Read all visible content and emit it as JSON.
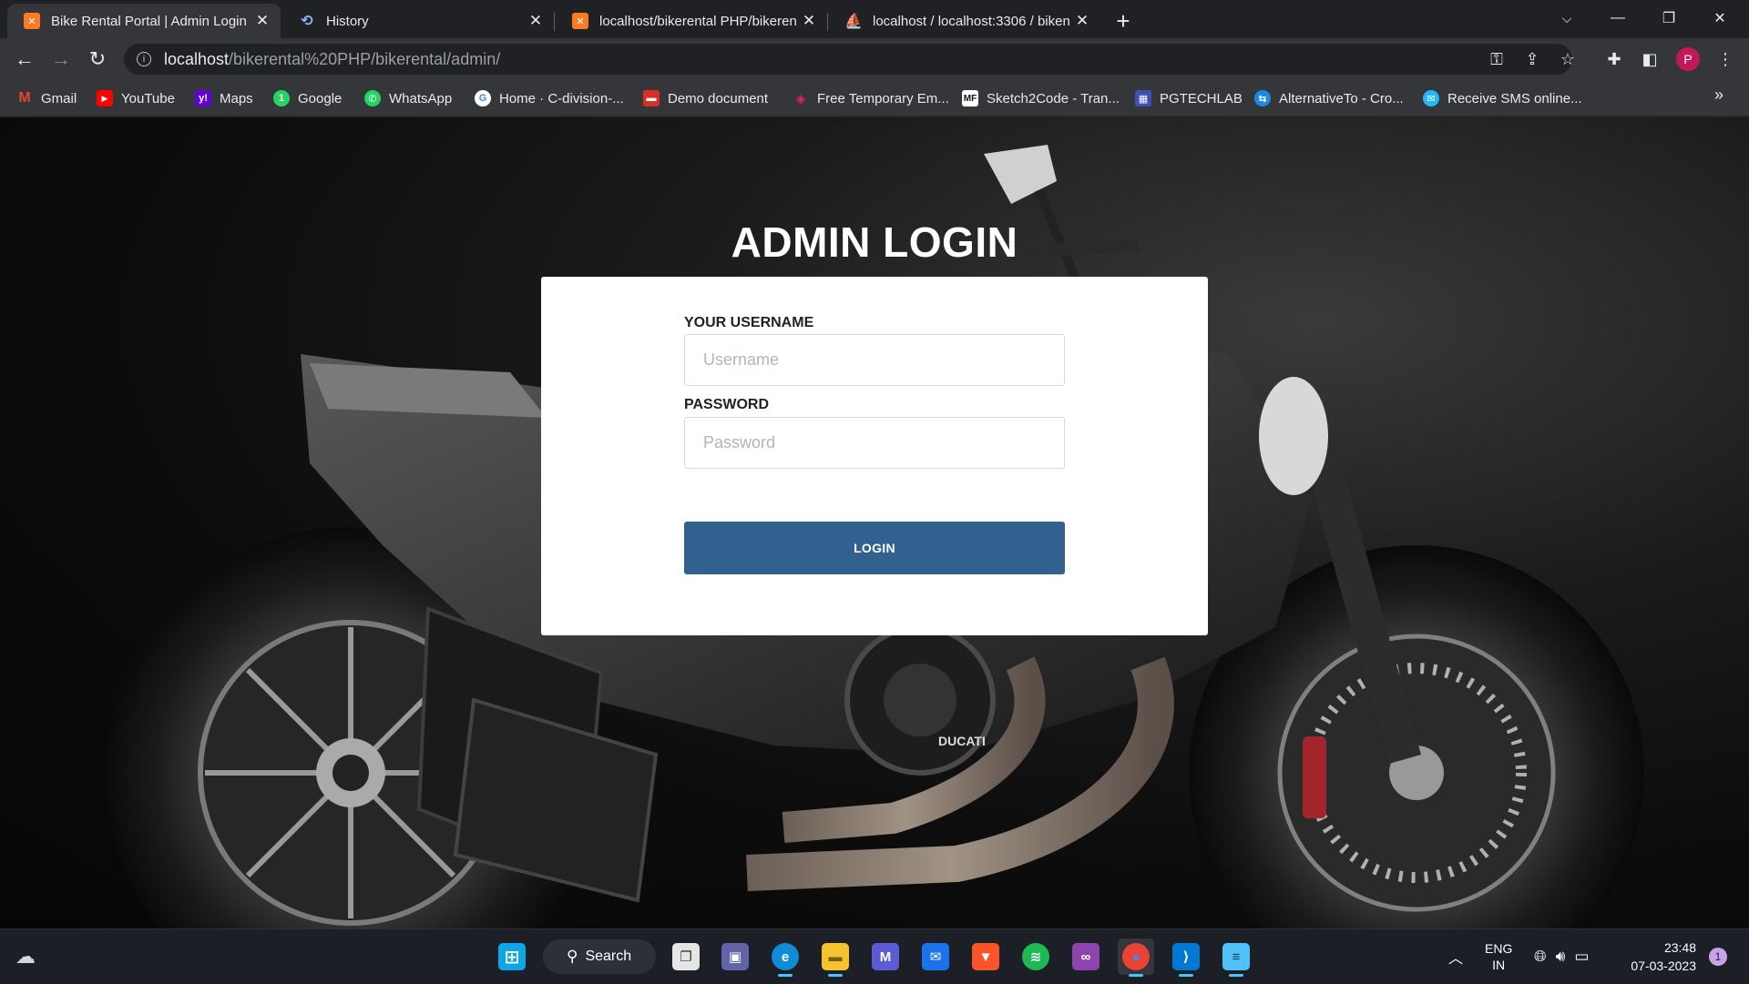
{
  "tabs": [
    {
      "title": "Bike Rental Portal | Admin Login",
      "active": true,
      "icon": "xampp-icon"
    },
    {
      "title": "History",
      "active": false,
      "icon": "history-icon"
    },
    {
      "title": "localhost/bikerental PHP/bikeren",
      "active": false,
      "icon": "xampp-icon"
    },
    {
      "title": "localhost / localhost:3306 / biken",
      "active": false,
      "icon": "phpmyadmin-icon"
    }
  ],
  "address_bar": {
    "host": "localhost",
    "path": "/bikerental%20PHP/bikerental/admin/"
  },
  "bookmarks": [
    {
      "label": "Gmail",
      "icon": "gmail-icon",
      "color": "#ea4335"
    },
    {
      "label": "YouTube",
      "icon": "youtube-icon",
      "color": "#ff0000"
    },
    {
      "label": "Maps",
      "icon": "yahoo-icon",
      "color": "#6001d2"
    },
    {
      "label": "Google",
      "icon": "whatsapp-green-icon",
      "color": "#25d366"
    },
    {
      "label": "WhatsApp",
      "icon": "whatsapp-icon",
      "color": "#25d366"
    },
    {
      "label": "Home · C-division-...",
      "icon": "google-icon",
      "color": "#ffffff"
    },
    {
      "label": "Demo document",
      "icon": "document-icon",
      "color": "#d93025"
    },
    {
      "label": "Free Temporary Em...",
      "icon": "mail-eye-icon",
      "color": "#e91e63"
    },
    {
      "label": "Sketch2Code - Tran...",
      "icon": "mf-icon",
      "color": "#ffffff"
    },
    {
      "label": "PGTECHLAB",
      "icon": "pgtechlab-icon",
      "color": "#3f51b5"
    },
    {
      "label": "AlternativeTo - Cro...",
      "icon": "alternativeto-icon",
      "color": "#1e88e5"
    },
    {
      "label": "Receive SMS online...",
      "icon": "sms-icon",
      "color": "#29b6f6"
    }
  ],
  "login": {
    "title": "ADMIN LOGIN",
    "username_label": "YOUR USERNAME",
    "username_placeholder": "Username",
    "password_label": "PASSWORD",
    "password_placeholder": "Password",
    "button": "LOGIN"
  },
  "taskbar": {
    "search_label": "Search",
    "apps": [
      "task-view-icon",
      "teams-icon",
      "edge-icon",
      "file-explorer-icon",
      "mathpix-icon",
      "mail-icon",
      "brave-icon",
      "spotify-icon",
      "arduino-icon",
      "chrome-icon",
      "vscode-icon",
      "notepad-icon"
    ],
    "language": "ENG",
    "region": "IN",
    "time": "23:48",
    "date": "07-03-2023",
    "notification_count": "1"
  }
}
